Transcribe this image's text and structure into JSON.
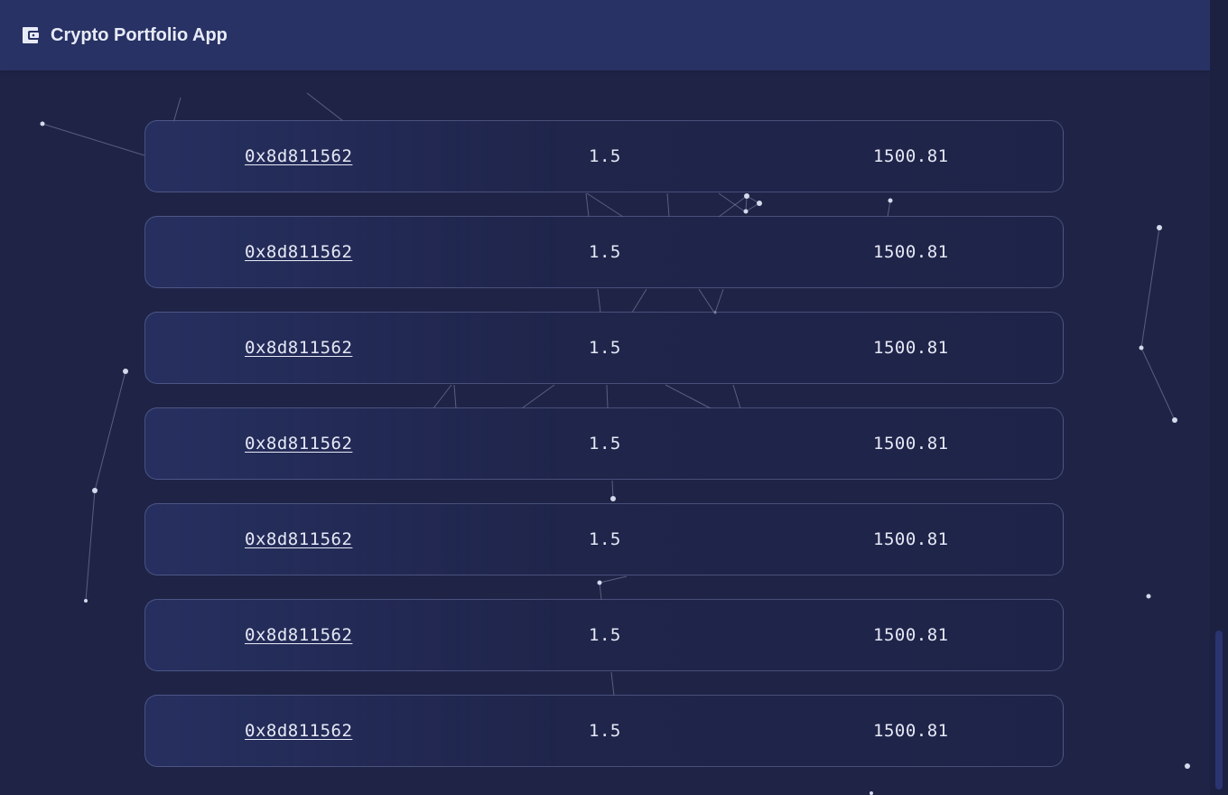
{
  "header": {
    "title": "Crypto Portfolio App",
    "icon": "wallet-icon"
  },
  "transactions": [
    {
      "hash": "0x8d811562",
      "amount": "1.5",
      "value": "1500.81"
    },
    {
      "hash": "0x8d811562",
      "amount": "1.5",
      "value": "1500.81"
    },
    {
      "hash": "0x8d811562",
      "amount": "1.5",
      "value": "1500.81"
    },
    {
      "hash": "0x8d811562",
      "amount": "1.5",
      "value": "1500.81"
    },
    {
      "hash": "0x8d811562",
      "amount": "1.5",
      "value": "1500.81"
    },
    {
      "hash": "0x8d811562",
      "amount": "1.5",
      "value": "1500.81"
    },
    {
      "hash": "0x8d811562",
      "amount": "1.5",
      "value": "1500.81"
    }
  ],
  "colors": {
    "background": "#1f2447",
    "header": "#283264",
    "text": "#e6e9f6"
  }
}
